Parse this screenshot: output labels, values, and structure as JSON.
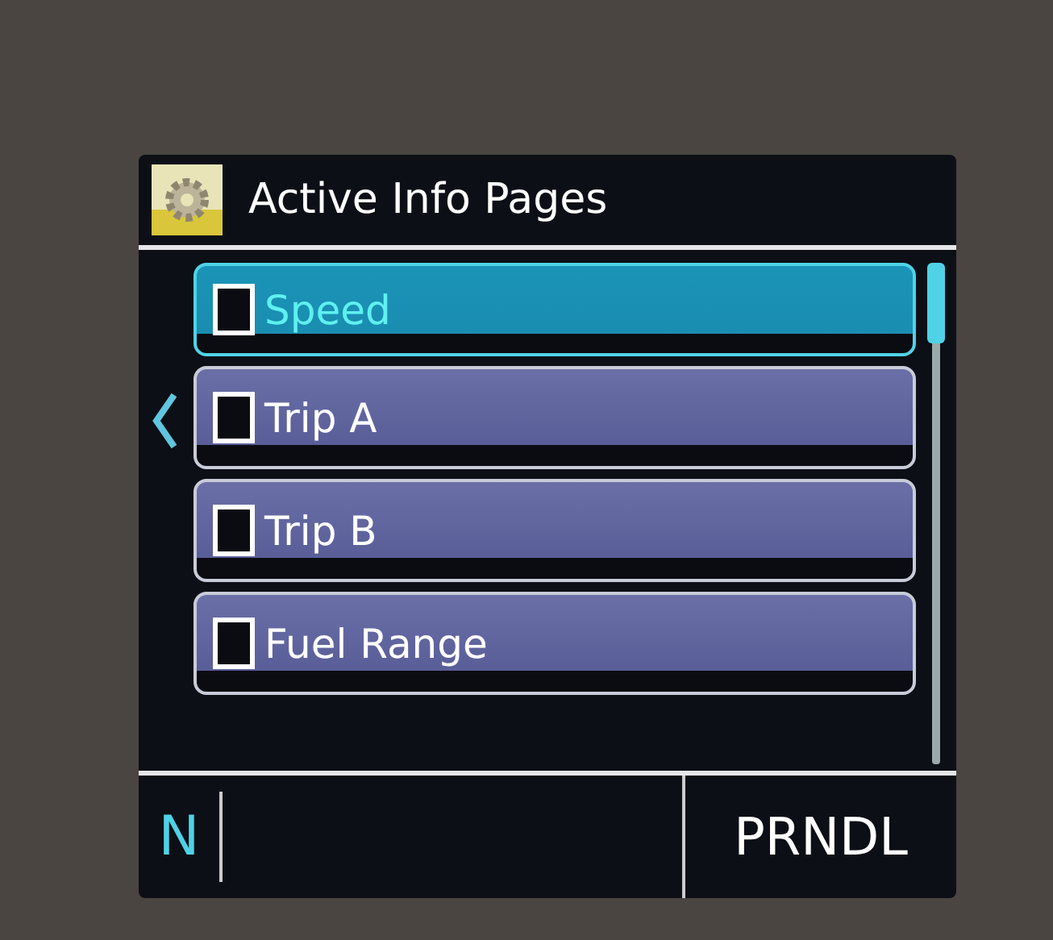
{
  "header": {
    "title": "Active Info Pages"
  },
  "items": [
    {
      "label": "Speed",
      "checked": false,
      "selected": true
    },
    {
      "label": "Trip A",
      "checked": false,
      "selected": false
    },
    {
      "label": "Trip B",
      "checked": false,
      "selected": false
    },
    {
      "label": "Fuel Range",
      "checked": false,
      "selected": false
    }
  ],
  "status_bar": {
    "gear": "N",
    "shift_mode": "PRNDL"
  }
}
